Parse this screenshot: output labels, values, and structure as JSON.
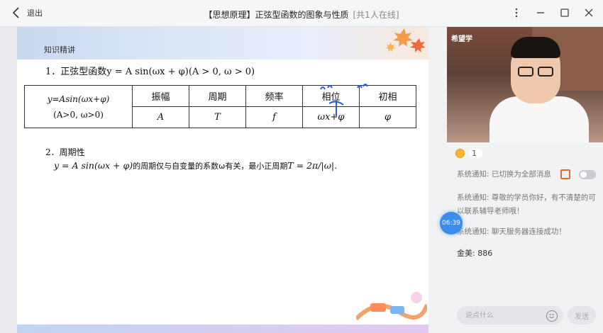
{
  "header": {
    "back_label": "退出",
    "title": "【思想原理】正弦型函数的图象与性质",
    "online": "[共1人在线]"
  },
  "slide": {
    "section_title": "知识精讲",
    "heading1": "1．正弦型函数y = A sin(ωx + φ)(A > 0, ω > 0)",
    "table": {
      "first_col": [
        "y=Asin(ωx+φ)",
        "(A>0, ω>0)"
      ],
      "headers": [
        "振幅",
        "周期",
        "频率",
        "相位",
        "初相"
      ],
      "values": [
        "A",
        "T",
        "f",
        "ωx+φ",
        "φ"
      ]
    },
    "heading2": "2．周期性",
    "period_text_a": "y = A sin(ωx + φ)",
    "period_text_b": "的周期仅与自变量的系数ω有关，最小正周期",
    "period_formula": "T = 2π/|ω|."
  },
  "sidebar": {
    "video_logo": "希望学",
    "likes_count": "1",
    "messages": [
      "系统通知: 已切换为全部消息",
      "系统通知: 尊敬的学员你好，有不清楚的可以联系辅导老师哦！",
      "系统通知: 聊天服务器连接成功！"
    ],
    "gold": "金美: 886",
    "timer": "06:39",
    "input_placeholder": "说点什么",
    "send_label": "发送"
  },
  "colors": {
    "accent": "#3b8de8",
    "coin": "#f5b82e",
    "gift": "#e36a2f"
  }
}
